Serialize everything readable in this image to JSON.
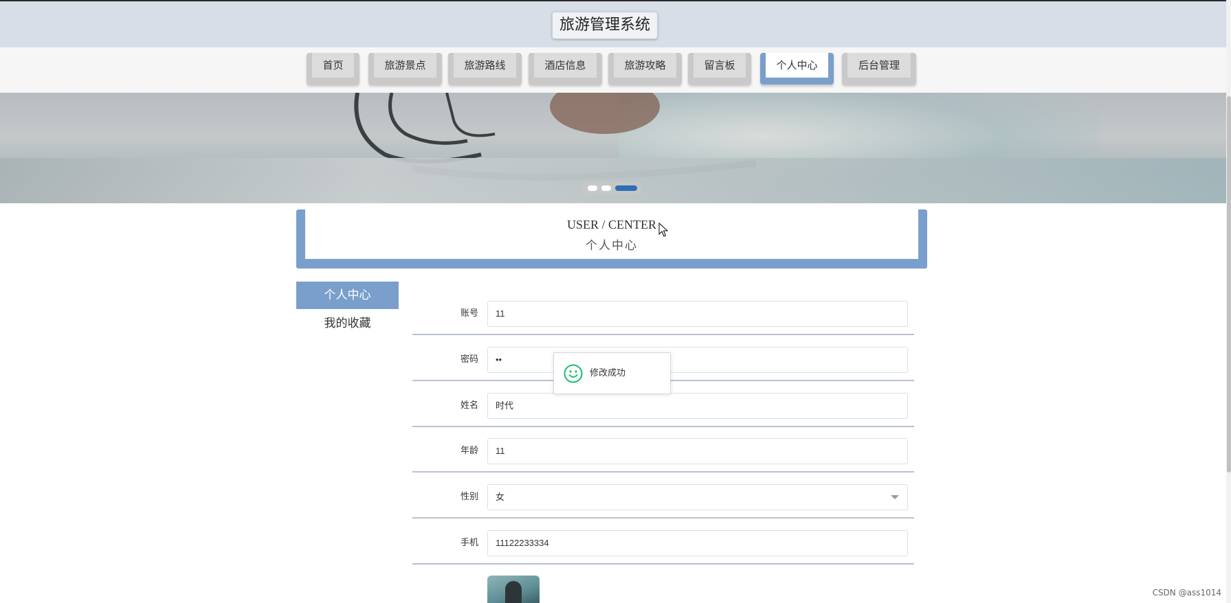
{
  "header": {
    "title": "旅游管理系统"
  },
  "nav": {
    "items": [
      {
        "label": "首页"
      },
      {
        "label": "旅游景点"
      },
      {
        "label": "旅游路线"
      },
      {
        "label": "酒店信息"
      },
      {
        "label": "旅游攻略"
      },
      {
        "label": "留言板"
      },
      {
        "label": "个人中心"
      },
      {
        "label": "后台管理"
      }
    ],
    "active": "个人中心"
  },
  "banner": {
    "slide_count": 3,
    "active_slide": 3
  },
  "section": {
    "title_en": "USER / CENTER",
    "title_cn": "个人中心"
  },
  "sidebar": {
    "items": [
      {
        "label": "个人中心"
      },
      {
        "label": "我的收藏"
      }
    ]
  },
  "form": {
    "account": {
      "label": "账号",
      "value": "11"
    },
    "password": {
      "label": "密码",
      "value": "••"
    },
    "name": {
      "label": "姓名",
      "value": "时代"
    },
    "age": {
      "label": "年龄",
      "value": "11"
    },
    "gender": {
      "label": "性别",
      "value": "女"
    },
    "phone": {
      "label": "手机",
      "value": "11122233334"
    }
  },
  "toast": {
    "message": "修改成功"
  },
  "watermark": "CSDN @ass1014",
  "colors": {
    "accent": "#7a9fcc",
    "header_bg": "#d8dee8",
    "success": "#19be6b",
    "dot_active": "#2e6fb5"
  }
}
